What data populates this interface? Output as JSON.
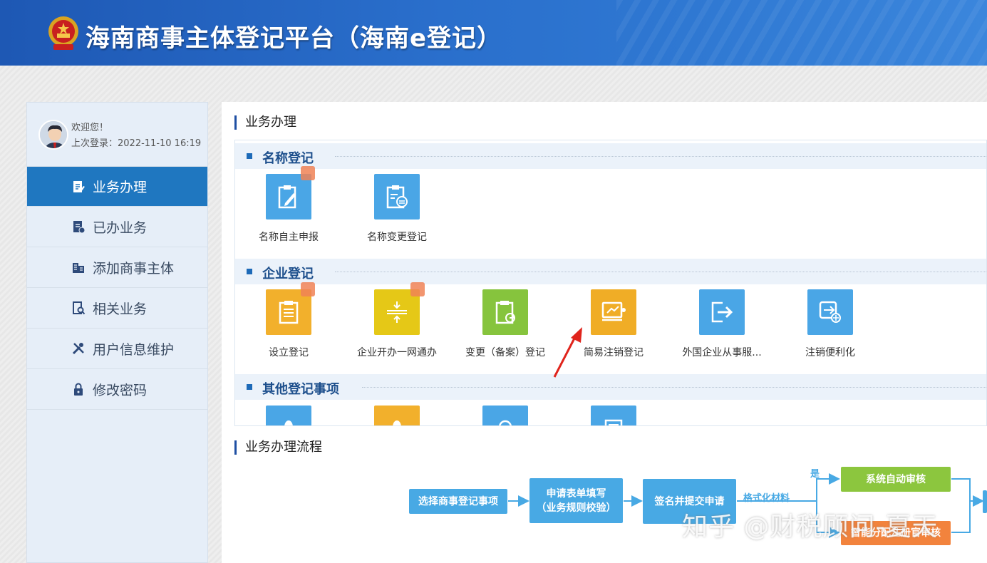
{
  "header": {
    "title": "海南商事主体登记平台（海南e登记）"
  },
  "user": {
    "welcome": "欢迎您！",
    "last_login": "上次登录：2022-11-10 16:19"
  },
  "sidebar": {
    "items": [
      {
        "label": "业务办理",
        "icon": "document-pen-icon",
        "active": true
      },
      {
        "label": "已办业务",
        "icon": "document-check-icon",
        "active": false
      },
      {
        "label": "添加商事主体",
        "icon": "building-icon",
        "active": false
      },
      {
        "label": "相关业务",
        "icon": "document-search-icon",
        "active": false
      },
      {
        "label": "用户信息维护",
        "icon": "tools-icon",
        "active": false
      },
      {
        "label": "修改密码",
        "icon": "lock-icon",
        "active": false
      }
    ]
  },
  "main": {
    "section_title": "业务办理",
    "categories": [
      {
        "label": "名称登记",
        "tiles": [
          {
            "name": "名称自主申报",
            "color": "#4aa6e6",
            "icon": "clipboard-pen-icon"
          },
          {
            "name": "名称变更登记",
            "color": "#4aa6e6",
            "icon": "clipboard-swap-icon"
          }
        ]
      },
      {
        "label": "企业登记",
        "tiles": [
          {
            "name": "设立登记",
            "color": "#f2b02c",
            "icon": "clipboard-list-icon"
          },
          {
            "name": "企业开办一网通办",
            "color": "#e5c817",
            "icon": "merge-arrows-icon"
          },
          {
            "name": "变更（备案）登记",
            "color": "#86c43d",
            "icon": "clipboard-refresh-icon"
          },
          {
            "name": "简易注销登记",
            "color": "#f0ad26",
            "icon": "monitor-exit-icon"
          },
          {
            "name": "外国企业从事服...",
            "color": "#4aa6e6",
            "icon": "exit-arrow-icon"
          },
          {
            "name": "注销便利化",
            "color": "#4aa6e6",
            "icon": "logout-plus-icon"
          }
        ]
      },
      {
        "label": "其他登记事项",
        "tiles": [
          {
            "name": "",
            "color": "#4aa6e6",
            "icon": "oval-icon"
          },
          {
            "name": "",
            "color": "#f2b02c",
            "icon": "oval-icon"
          },
          {
            "name": "",
            "color": "#4aa6e6",
            "icon": "search-icon"
          },
          {
            "name": "",
            "color": "#4aa6e6",
            "icon": "document-icon"
          }
        ]
      }
    ]
  },
  "flow": {
    "title": "业务办理流程",
    "step1": "选择商事登记事项",
    "step2_line1": "申请表单填写",
    "step2_line2": "（业务规则校验）",
    "step3": "签名并提交申请",
    "label_format": "格式化材料",
    "label_yes": "是",
    "step_auto": "系统自动审核",
    "step_manual": "智能分配注册官审核"
  },
  "watermark": "知乎 @财税顾问-夏天"
}
